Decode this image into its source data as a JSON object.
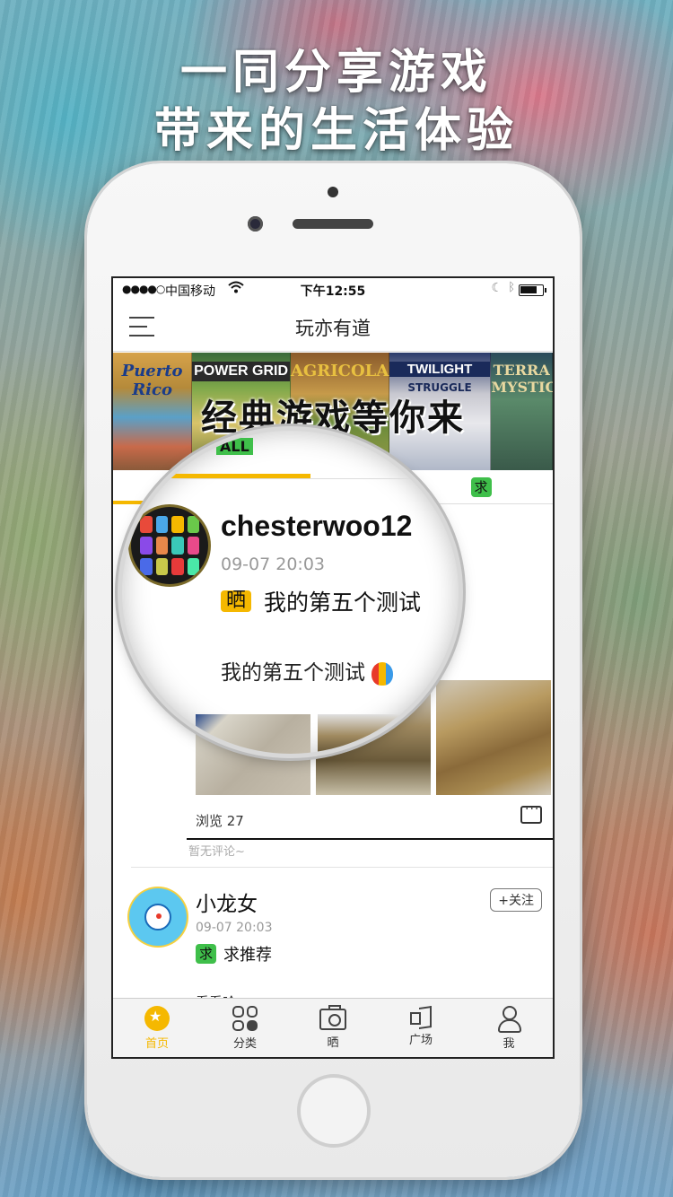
{
  "headline": {
    "line1": "一同分享游戏",
    "line2": "带来的生活体验"
  },
  "status_bar": {
    "signal": "●●●●○",
    "carrier": "中国移动",
    "time": "下午12:55"
  },
  "nav": {
    "title": "玩亦有道"
  },
  "banner": {
    "overlay_text": "经典游戏等你来",
    "boxes": [
      "Puerto Rico",
      "POWER GRID",
      "AGRICOLA",
      "TWILIGHT",
      "TERRA MYSTICA"
    ],
    "box4_sub": "STRUGGLE"
  },
  "tabs": {
    "all_label": "ALL",
    "qiu_label": "求"
  },
  "posts": [
    {
      "username": "chesterwoo12",
      "date": "09-07 20:03",
      "tag": "晒",
      "title": "我的第五个测试",
      "body": "我的第五个测试",
      "views": "浏览 27",
      "no_comment": "暂无评论~"
    },
    {
      "username": "小龙女",
      "date": "09-07 20:03",
      "tag": "求",
      "title": "求推荐",
      "follow": "+关注",
      "body_cut": "看看哈"
    }
  ],
  "tabbar": [
    {
      "label": "首页",
      "icon": "home-icon",
      "active": true
    },
    {
      "label": "分类",
      "icon": "category-icon",
      "active": false
    },
    {
      "label": "晒",
      "icon": "camera-icon",
      "active": false
    },
    {
      "label": "广场",
      "icon": "megaphone-icon",
      "active": false
    },
    {
      "label": "我",
      "icon": "person-icon",
      "active": false
    }
  ],
  "colors": {
    "accent_yellow": "#f5b800",
    "tag_green": "#3fbf4a"
  }
}
